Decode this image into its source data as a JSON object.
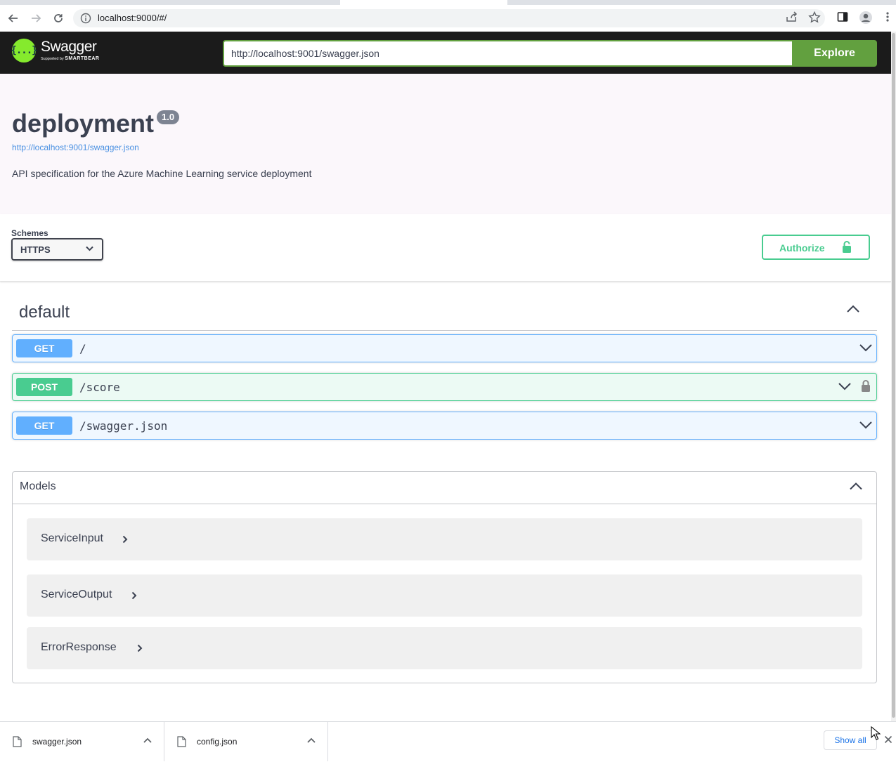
{
  "browser": {
    "url": "localhost:9000/#/"
  },
  "topbar": {
    "brand": "Swagger",
    "tagline_prefix": "Supported by",
    "tagline_brand": "SMARTBEAR",
    "logo_glyph": "{...}",
    "url_value": "http://localhost:9001/swagger.json",
    "explore_label": "Explore"
  },
  "info": {
    "title": "deployment",
    "version": "1.0",
    "spec_url": "http://localhost:9001/swagger.json",
    "description": "API specification for the Azure Machine Learning service deployment"
  },
  "schemes": {
    "label": "Schemes",
    "selected": "HTTPS"
  },
  "authorize": {
    "label": "Authorize"
  },
  "tag": {
    "name": "default"
  },
  "operations": [
    {
      "method": "GET",
      "path": "/",
      "locked": false
    },
    {
      "method": "POST",
      "path": "/score",
      "locked": true
    },
    {
      "method": "GET",
      "path": "/swagger.json",
      "locked": false
    }
  ],
  "models": {
    "title": "Models",
    "items": [
      "ServiceInput",
      "ServiceOutput",
      "ErrorResponse"
    ]
  },
  "downloads": {
    "items": [
      "swagger.json",
      "config.json"
    ],
    "show_all_label": "Show all"
  },
  "colors": {
    "get": "#61affe",
    "post": "#49cc90",
    "explore": "#62a03f",
    "topbar": "#1b1b1b"
  }
}
